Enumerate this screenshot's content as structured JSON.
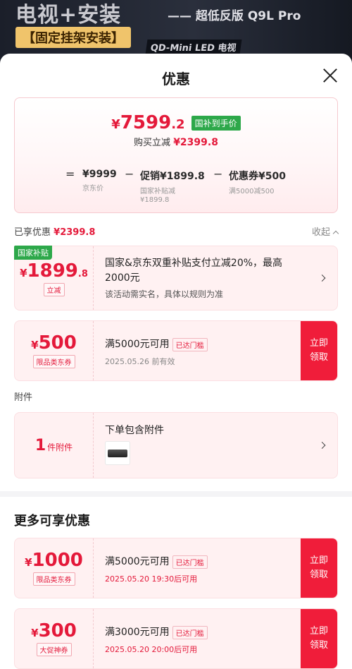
{
  "banner": {
    "headline": "电视+安装",
    "tag": "【固定挂架安装】",
    "product": "—— 超低反版 Q9L Pro",
    "tech": "QD-Mini LED 电视"
  },
  "sheet": {
    "title": "优惠"
  },
  "summary": {
    "price_yen": "¥",
    "price_int": "7599",
    "price_dec": ".2",
    "badge": "国补到手价",
    "instant_label": "购买立减",
    "instant_value": "¥2399.8",
    "formula": {
      "eq": "=",
      "jd_price": "¥9999",
      "jd_price_label": "京东价",
      "minus1": "−",
      "promo": "促销¥1899.8",
      "promo_label": "国家补贴减",
      "promo_label_value": "¥1899.8",
      "minus2": "−",
      "coupon": "优惠券¥500",
      "coupon_label": "满5000减500"
    }
  },
  "enjoyed": {
    "label": "已享优惠",
    "value": "¥2399.8",
    "collapse": "收起"
  },
  "subsidy": {
    "corner": "国家补贴",
    "yen": "¥",
    "int": "1899",
    "dec": ".8",
    "tag": "立减",
    "title_line1": "国家&京东双重补贴支付立减20%，最高",
    "title_line2": "2000元",
    "note": "该活动需实名，具体以规则为准"
  },
  "coupon500": {
    "yen": "¥",
    "int": "500",
    "tag": "限品类东券",
    "title": "满5000元可用",
    "threshold": "已达门槛",
    "sub": "2025.05.26 前有效",
    "claim": "立即领取"
  },
  "accessory_section": {
    "label": "附件",
    "count": "1",
    "count_unit": "件附件",
    "title": "下单包含附件"
  },
  "more": {
    "title": "更多可享优惠",
    "coupons": [
      {
        "yen": "¥",
        "int": "1000",
        "tag": "限品类东券",
        "title": "满5000元可用",
        "threshold": "已达门槛",
        "sub": "2025.05.20  19:30后可用",
        "claim": "立即领取"
      },
      {
        "yen": "¥",
        "int": "300",
        "tag": "大促神券",
        "title": "满3000元可用",
        "threshold": "已达门槛",
        "sub": "2025.05.20  20:00后可用",
        "claim": "立即领取"
      }
    ]
  },
  "colors": {
    "accent_red": "#e4193a",
    "claim_red": "#f01d3a",
    "gov_green": "#2da84a"
  }
}
